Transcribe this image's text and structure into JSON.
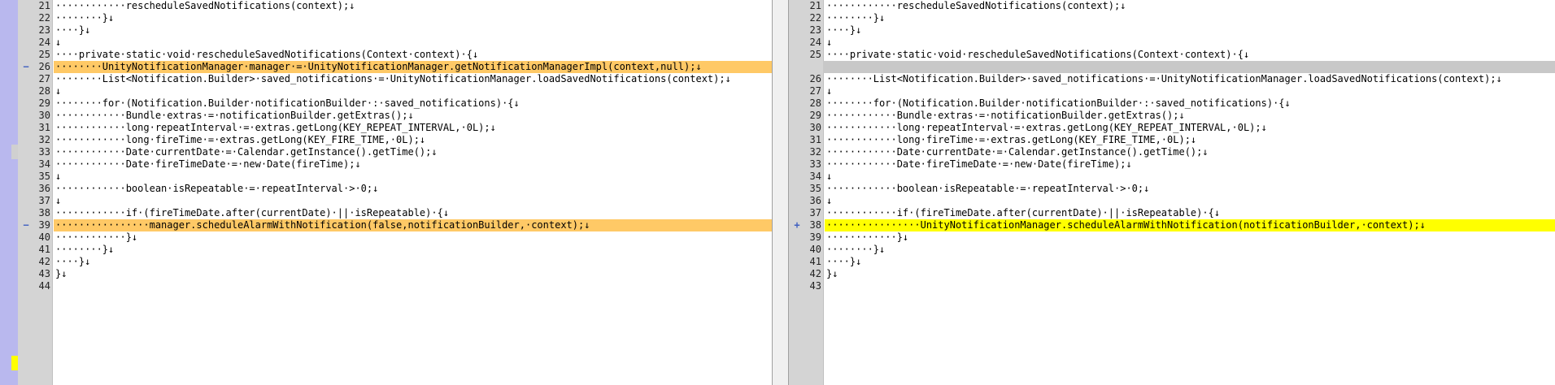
{
  "colors": {
    "overview": "#b9b8ee",
    "gutter": "#d4d4d4",
    "changed_line": "#ffc966",
    "added_line": "#ffff00",
    "removed_token": "#e27a7a",
    "gap_bar": "#c8c8c8"
  },
  "icons": {
    "line_end": "↓",
    "whitespace_dot": "·"
  },
  "left": {
    "lines": [
      {
        "n": "21",
        "code": "············rescheduleSavedNotifications(context);↓",
        "state": "",
        "mark": ""
      },
      {
        "n": "22",
        "code": "········}↓",
        "state": "",
        "mark": ""
      },
      {
        "n": "23",
        "code": "····}↓",
        "state": "",
        "mark": ""
      },
      {
        "n": "24",
        "code": "↓",
        "state": "",
        "mark": ""
      },
      {
        "n": "25",
        "code": "····private·static·void·rescheduleSavedNotifications(Context·context)·{↓",
        "state": "",
        "mark": ""
      },
      {
        "n": "26",
        "code": "········UnityNotificationManager·manager·=·UnityNotificationManager.getNotificationManagerImpl(context,null);↓",
        "state": "chg",
        "mark": "−"
      },
      {
        "n": "27",
        "code": "········List<Notification.Builder>·saved_notifications·=·UnityNotificationManager.loadSavedNotifications(context);↓",
        "state": "",
        "mark": ""
      },
      {
        "n": "28",
        "code": "↓",
        "state": "",
        "mark": ""
      },
      {
        "n": "29",
        "code": "········for·(Notification.Builder·notificationBuilder·:·saved_notifications)·{↓",
        "state": "",
        "mark": ""
      },
      {
        "n": "30",
        "code": "············Bundle·extras·=·notificationBuilder.getExtras();↓",
        "state": "",
        "mark": ""
      },
      {
        "n": "31",
        "code": "············long·repeatInterval·=·extras.getLong(KEY_REPEAT_INTERVAL,·0L);↓",
        "state": "",
        "mark": ""
      },
      {
        "n": "32",
        "code": "············long·fireTime·=·extras.getLong(KEY_FIRE_TIME,·0L);↓",
        "state": "",
        "mark": ""
      },
      {
        "n": "33",
        "code": "············Date·currentDate·=·Calendar.getInstance().getTime();↓",
        "state": "",
        "mark": ""
      },
      {
        "n": "34",
        "code": "············Date·fireTimeDate·=·new·Date(fireTime);↓",
        "state": "",
        "mark": ""
      },
      {
        "n": "35",
        "code": "↓",
        "state": "",
        "mark": ""
      },
      {
        "n": "36",
        "code": "············boolean·isRepeatable·=·repeatInterval·>·0;↓",
        "state": "",
        "mark": ""
      },
      {
        "n": "37",
        "code": "↓",
        "state": "",
        "mark": ""
      },
      {
        "n": "38",
        "code": "············if·(fireTimeDate.after(currentDate)·||·isRepeatable)·{↓",
        "state": "",
        "mark": ""
      },
      {
        "n": "39",
        "code": "················manager.scheduleAlarmWithNotification(false,notificationBuilder,·context);↓",
        "state": "chg",
        "mark": "−"
      },
      {
        "n": "40",
        "code": "············}↓",
        "state": "",
        "mark": ""
      },
      {
        "n": "41",
        "code": "········}↓",
        "state": "",
        "mark": ""
      },
      {
        "n": "42",
        "code": "····}↓",
        "state": "",
        "mark": ""
      },
      {
        "n": "43",
        "code": "}↓",
        "state": "",
        "mark": ""
      },
      {
        "n": "44",
        "code": "",
        "state": "",
        "mark": ""
      }
    ]
  },
  "right": {
    "lines": [
      {
        "n": "21",
        "code": "············rescheduleSavedNotifications(context);↓",
        "state": "",
        "mark": ""
      },
      {
        "n": "22",
        "code": "········}↓",
        "state": "",
        "mark": ""
      },
      {
        "n": "23",
        "code": "····}↓",
        "state": "",
        "mark": ""
      },
      {
        "n": "24",
        "code": "↓",
        "state": "",
        "mark": ""
      },
      {
        "n": "25",
        "code": "····private·static·void·rescheduleSavedNotifications(Context·context)·{↓",
        "state": "",
        "mark": ""
      },
      {
        "n": "",
        "code": "",
        "state": "gap",
        "mark": ""
      },
      {
        "n": "26",
        "code": "········List<Notification.Builder>·saved_notifications·=·UnityNotificationManager.loadSavedNotifications(context);↓",
        "state": "",
        "mark": ""
      },
      {
        "n": "27",
        "code": "↓",
        "state": "",
        "mark": ""
      },
      {
        "n": "28",
        "code": "········for·(Notification.Builder·notificationBuilder·:·saved_notifications)·{↓",
        "state": "",
        "mark": ""
      },
      {
        "n": "29",
        "code": "············Bundle·extras·=·notificationBuilder.getExtras();↓",
        "state": "",
        "mark": ""
      },
      {
        "n": "30",
        "code": "············long·repeatInterval·=·extras.getLong(KEY_REPEAT_INTERVAL,·0L);↓",
        "state": "",
        "mark": ""
      },
      {
        "n": "31",
        "code": "············long·fireTime·=·extras.getLong(KEY_FIRE_TIME,·0L);↓",
        "state": "",
        "mark": ""
      },
      {
        "n": "32",
        "code": "············Date·currentDate·=·Calendar.getInstance().getTime();↓",
        "state": "",
        "mark": ""
      },
      {
        "n": "33",
        "code": "············Date·fireTimeDate·=·new·Date(fireTime);↓",
        "state": "",
        "mark": ""
      },
      {
        "n": "34",
        "code": "↓",
        "state": "",
        "mark": ""
      },
      {
        "n": "35",
        "code": "············boolean·isRepeatable·=·repeatInterval·>·0;↓",
        "state": "",
        "mark": ""
      },
      {
        "n": "36",
        "code": "↓",
        "state": "",
        "mark": ""
      },
      {
        "n": "37",
        "code": "············if·(fireTimeDate.after(currentDate)·||·isRepeatable)·{↓",
        "state": "",
        "mark": ""
      },
      {
        "n": "38",
        "code": "················UnityNotificationManager.scheduleAlarmWithNotification(notificationBuilder,·context);↓",
        "state": "add",
        "mark": "+"
      },
      {
        "n": "39",
        "code": "············}↓",
        "state": "",
        "mark": ""
      },
      {
        "n": "40",
        "code": "········}↓",
        "state": "",
        "mark": ""
      },
      {
        "n": "41",
        "code": "····}↓",
        "state": "",
        "mark": ""
      },
      {
        "n": "42",
        "code": "}↓",
        "state": "",
        "mark": ""
      },
      {
        "n": "43",
        "code": "",
        "state": "",
        "mark": ""
      }
    ]
  }
}
